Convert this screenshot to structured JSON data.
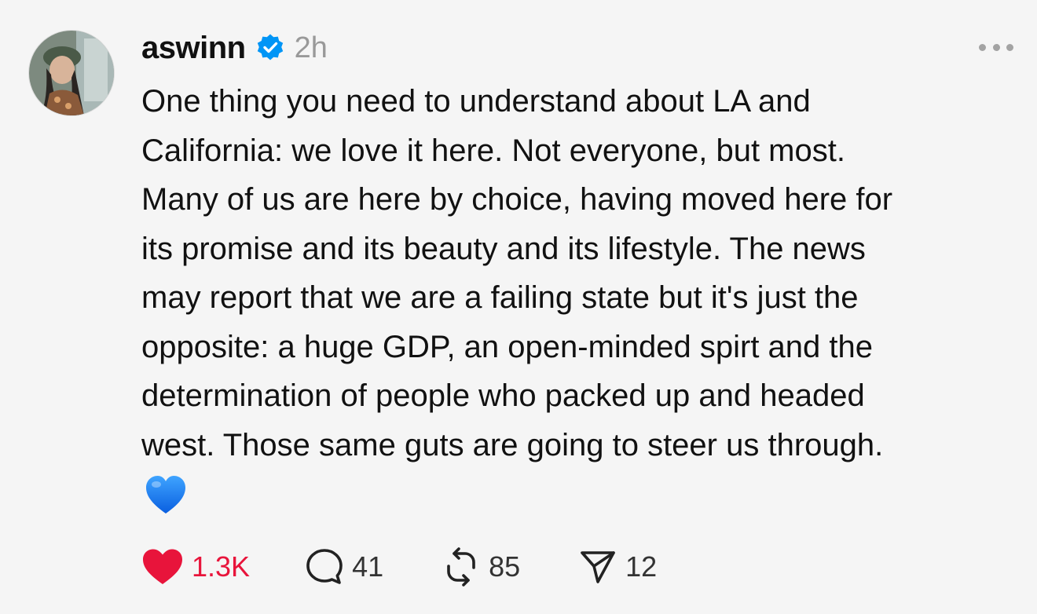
{
  "post": {
    "username": "aswinn",
    "time": "2h",
    "body_lines": [
      "One thing you need to understand about LA and",
      "California: we love it here. Not everyone, but most.",
      "Many of us are here by choice, having moved here for",
      "its promise and its beauty and its lifestyle. The news",
      "may report that we are a failing state but it's just the",
      "opposite: a huge GDP, an open-minded spirt and the",
      "determination of people who packed up and headed",
      "west. Those same guts are going to steer us through."
    ],
    "emoji": "blue-heart-icon"
  },
  "actions": {
    "likes": "1.3K",
    "replies": "41",
    "reposts": "85",
    "shares": "12"
  },
  "colors": {
    "like": "#e8143b",
    "verified": "#0095f6",
    "muted": "#999999",
    "background": "#f5f5f5"
  }
}
